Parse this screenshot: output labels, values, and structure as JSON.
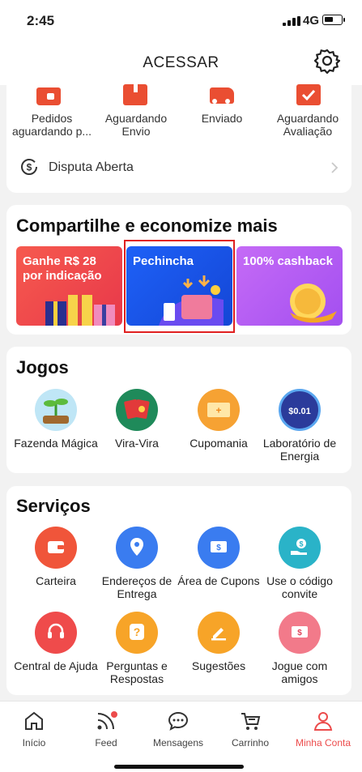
{
  "status_bar": {
    "time": "2:45",
    "network": "4G"
  },
  "header": {
    "title": "ACESSAR"
  },
  "orders": {
    "items": [
      {
        "label": "Pedidos aguardando p..."
      },
      {
        "label": "Aguardando Envio"
      },
      {
        "label": "Enviado"
      },
      {
        "label": "Aguardando Avaliação"
      }
    ],
    "dispute": {
      "label": "Disputa Aberta"
    }
  },
  "share": {
    "title": "Compartilhe e economize mais",
    "promos": [
      {
        "label": "Ganhe R$ 28 por indicação",
        "color": "#f24b4b"
      },
      {
        "label": "Pechincha",
        "color": "#1a5cf5"
      },
      {
        "label": "100% cashback",
        "color": "#b463f2"
      }
    ]
  },
  "games": {
    "title": "Jogos",
    "items": [
      {
        "label": "Fazenda Mágica"
      },
      {
        "label": "Vira-Vira"
      },
      {
        "label": "Cupomania"
      },
      {
        "label": "Laboratório de Energia",
        "badge": "$0.01"
      }
    ]
  },
  "services": {
    "title": "Serviços",
    "items": [
      {
        "label": "Carteira"
      },
      {
        "label": "Endereços de Entrega"
      },
      {
        "label": "Área de Cupons"
      },
      {
        "label": "Use o código convite"
      },
      {
        "label": "Central de Ajuda"
      },
      {
        "label": "Perguntas e Respostas"
      },
      {
        "label": "Sugestões"
      },
      {
        "label": "Jogue com amigos"
      }
    ]
  },
  "bottom_nav": {
    "items": [
      {
        "label": "Início"
      },
      {
        "label": "Feed"
      },
      {
        "label": "Mensagens"
      },
      {
        "label": "Carrinho"
      },
      {
        "label": "Minha Conta",
        "active": true
      }
    ],
    "active_color": "#ec4b4b"
  }
}
